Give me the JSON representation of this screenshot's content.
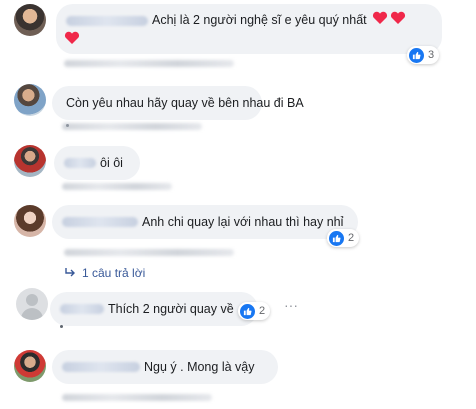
{
  "comments": [
    {
      "text": "Achị là 2 người nghệ sĩ e yêu quý nhất",
      "hearts": 3,
      "likes": "3"
    },
    {
      "text": "Còn yêu nhau hãy quay về bên nhau đi BA"
    },
    {
      "text": "ôi ôi"
    },
    {
      "text": "Anh chi quay lại với nhau thì hay nhỉ",
      "likes": "2"
    },
    {
      "text": "Thích 2 người quay về",
      "likes": "2"
    },
    {
      "text": "Ngụ ý . Mong là vậy"
    }
  ],
  "replies_link": {
    "label": "1 câu trả lời"
  },
  "more_icon": "···",
  "colors": {
    "link": "#385898",
    "like": "#1877f2",
    "heart": "#f0284a",
    "bubble": "#f0f2f5"
  }
}
